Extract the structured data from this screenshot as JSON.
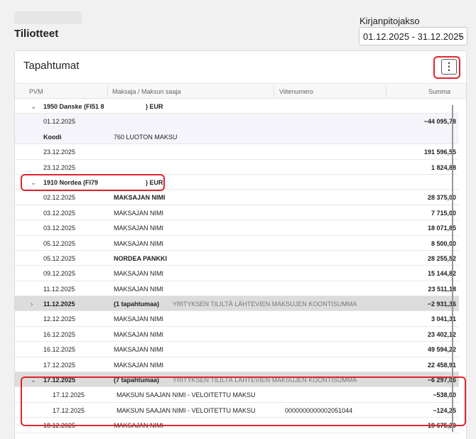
{
  "page": {
    "title": "Tiliotteet"
  },
  "period": {
    "label": "Kirjanpitojakso",
    "value": "01.12.2025 - 31.12.2025"
  },
  "panel": {
    "title": "Tapahtumat",
    "menu_icon": "vertical-dots-icon"
  },
  "columns": {
    "date": "PVM",
    "payee": "Maksaja / Maksun saaja",
    "ref": "Viitenumero",
    "amount": "Summa"
  },
  "groups": [
    {
      "label": "1950 Danske (FI51 8",
      "suffix": ") EUR"
    },
    {
      "label": "1910 Nordea (FI79 ",
      "suffix": ") EUR"
    }
  ],
  "rows": [
    {
      "date": "01.12.2025",
      "payee": "",
      "ref": "",
      "amount": "−44 095,78"
    },
    {
      "date": "Koodi",
      "payee": "760 LUOTON MAKSU",
      "ref": "",
      "amount": ""
    },
    {
      "date": "23.12.2025",
      "payee": "",
      "ref": "",
      "amount": "191 596,55"
    },
    {
      "date": "23.12.2025",
      "payee": "",
      "ref": "",
      "amount": "1 824,88"
    },
    {
      "date": "02.12.2025",
      "payee": "MAKSAJAN NIMI",
      "ref": "",
      "amount": "28 375,00"
    },
    {
      "date": "03.12.2025",
      "payee": "MAKSAJAN NIMI",
      "ref": "",
      "amount": "7 715,00"
    },
    {
      "date": "03.12.2025",
      "payee": "MAKSAJAN NIMI",
      "ref": "",
      "amount": "18 071,85"
    },
    {
      "date": "05.12.2025",
      "payee": "MAKSAJAN NIMI",
      "ref": "",
      "amount": "8 500,00"
    },
    {
      "date": "05.12.2025",
      "payee": "NORDEA PANKKI",
      "ref": "",
      "amount": "28 255,52"
    },
    {
      "date": "09.12.2025",
      "payee": "MAKSAJAN NIMI",
      "ref": "",
      "amount": "15 144,82"
    },
    {
      "date": "11.12.2025",
      "payee": "MAKSAJAN NIMI",
      "ref": "",
      "amount": "23 511,18"
    },
    {
      "date": "11.12.2025",
      "payee": "(1 tapahtumaa)",
      "ref": "YRITYKSEN TILILTÄ LÄHTEVIEN MAKSUJEN KOONTISUMMA",
      "amount": "−2 931,36"
    },
    {
      "date": "12.12.2025",
      "payee": "MAKSAJAN NIMI",
      "ref": "",
      "amount": "3 041,31"
    },
    {
      "date": "16.12.2025",
      "payee": "MAKSAJAN NIMI",
      "ref": "",
      "amount": "23 402,12"
    },
    {
      "date": "16.12.2025",
      "payee": "MAKSAJAN NIMI",
      "ref": "",
      "amount": "49 594,22"
    },
    {
      "date": "17.12.2025",
      "payee": "MAKSAJAN NIMI",
      "ref": "",
      "amount": "22 458,91"
    },
    {
      "date": "17.12.2025",
      "payee": "(7 tapahtumaa)",
      "ref": "YRITYKSEN TILILTÄ LÄHTEVIEN MAKSUJEN KOONTISUMMA",
      "amount": "−6 297,06"
    },
    {
      "date": "17.12.2025",
      "payee": "MAKSUN SAAJAN NIMI - VELOITETTU MAKSU",
      "ref": "",
      "amount": "−538,00"
    },
    {
      "date": "17.12.2025",
      "payee": "MAKSUN SAAJAN NIMI - VELOITETTU MAKSU",
      "ref": "0000000000002051044",
      "amount": "−124,25"
    },
    {
      "date": "18.12.2025",
      "payee": "MAKSAJAN NIMI",
      "ref": "",
      "amount": "19 675,20"
    }
  ],
  "colors": {
    "highlight": "#e0252d",
    "summary_row": "#dcdcdc"
  }
}
